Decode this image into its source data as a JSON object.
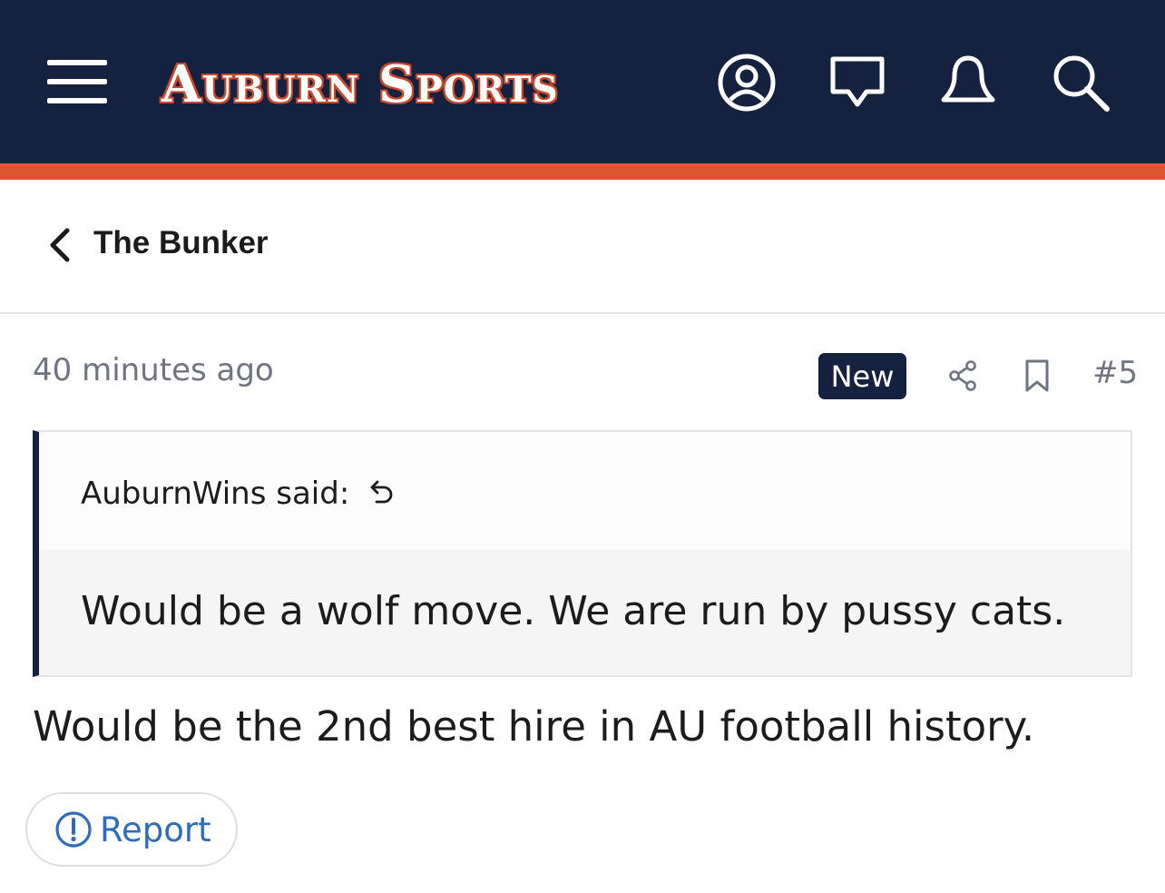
{
  "header": {
    "brand": "Auburn Sports",
    "icons": {
      "menu": "hamburger-menu-icon",
      "account": "account-icon",
      "conversations": "chat-bubble-icon",
      "alerts": "bell-icon",
      "search": "search-icon"
    },
    "colors": {
      "background": "#14223f",
      "accent": "#dd5532"
    }
  },
  "breadcrumb": {
    "title": "The Bunker"
  },
  "post": {
    "time": "40 minutes ago",
    "badge": "New",
    "number": "#5",
    "quote": {
      "author_line": "AuburnWins said:",
      "text": "Would be a wolf move. We are run by pussy cats."
    },
    "body": "Would be the 2nd best hire in AU football history.",
    "report_label": "Report"
  }
}
